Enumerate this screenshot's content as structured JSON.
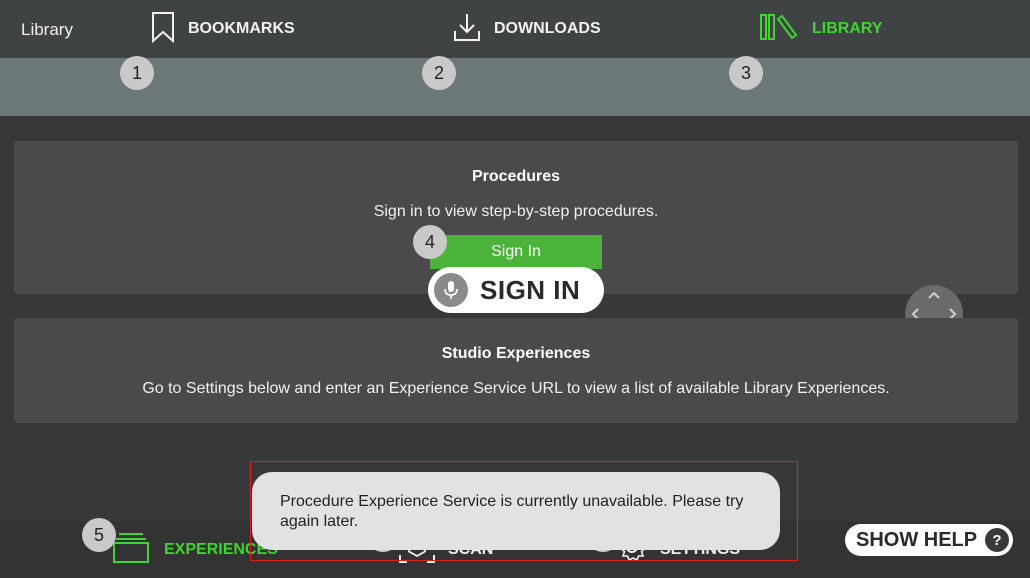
{
  "header": {
    "title": "Library"
  },
  "tabs": [
    {
      "label": "BOOKMARKS",
      "badge": "1",
      "icon": "bookmark-icon"
    },
    {
      "label": "DOWNLOADS",
      "badge": "2",
      "icon": "download-icon"
    },
    {
      "label": "LIBRARY",
      "badge": "3",
      "icon": "library-books-icon",
      "active": true
    }
  ],
  "procedures": {
    "title": "Procedures",
    "text": "Sign in to view step-by-step procedures.",
    "button_label": "Sign In",
    "badge": "4"
  },
  "voice_command": {
    "label": "SIGN IN",
    "icon": "microphone-icon"
  },
  "studio": {
    "title": "Studio Experiences",
    "text": "Go to Settings below and enter an Experience Service URL to view a list of available Library Experiences."
  },
  "bottom_nav": [
    {
      "label": "EXPERIENCES",
      "badge": "5",
      "icon": "experiences-icon",
      "active": true
    },
    {
      "label": "SCAN",
      "badge": "6",
      "icon": "scan-icon"
    },
    {
      "label": "SETTINGS",
      "badge": "7",
      "icon": "gear-icon"
    }
  ],
  "toast": {
    "message": "Procedure Experience Service is currently unavailable. Please try again later."
  },
  "help": {
    "label": "SHOW HELP",
    "icon_text": "?"
  },
  "colors": {
    "accent_green": "#3fd42f",
    "button_green": "#4bb33a",
    "highlight_red": "#e0201a",
    "tabbar": "#6c7779",
    "background": "#383838"
  }
}
